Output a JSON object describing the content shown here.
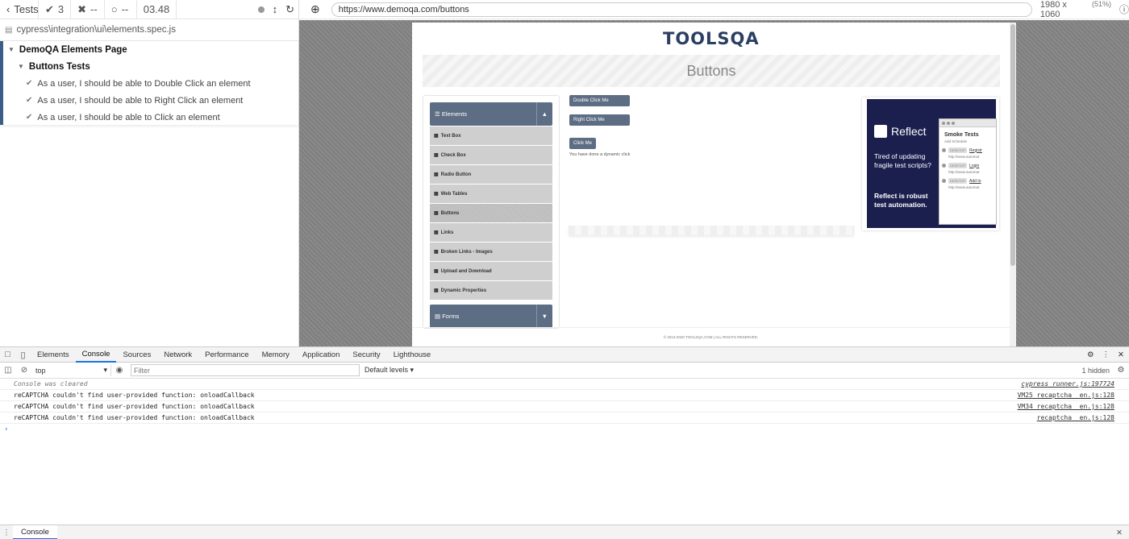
{
  "reporter": {
    "tests_label": "Tests",
    "passed": "3",
    "failed": "--",
    "pending": "--",
    "duration": "03.48",
    "spec_path": "cypress\\integration\\ui\\elements.spec.js",
    "suite": "DemoQA Elements Page",
    "subsuite": "Buttons Tests",
    "tests": [
      "As a user, I should be able to Double Click an element",
      "As a user, I should be able to Right Click an element",
      "As a user, I should be able to Click an element"
    ]
  },
  "urlbar": {
    "url": "https://www.demoqa.com/buttons",
    "viewport": "1980 x 1060",
    "scale": "(51%)"
  },
  "aut": {
    "logo_tools": "TOOLS",
    "logo_qa": "QA",
    "page_title": "Buttons",
    "groups": {
      "elements": "Elements",
      "forms": "Forms"
    },
    "menu": [
      "Text Box",
      "Check Box",
      "Radio Button",
      "Web Tables",
      "Buttons",
      "Links",
      "Broken Links - Images",
      "Upload and Download",
      "Dynamic Properties"
    ],
    "buttons": {
      "double": "Double Click Me",
      "right": "Right Click Me",
      "click": "Click Me"
    },
    "dynamic_message": "You have done a dynamic click",
    "ad": {
      "brand": "Reflect",
      "copy1": "Tired of updating fragile test scripts?",
      "copy2": "Reflect is robust test automation.",
      "shot_title": "Smoke Tests",
      "shot_sub": "Add Schedule",
      "rows": [
        "Registr",
        "Login",
        "Add to"
      ],
      "row_urls": [
        "http://www.automat",
        "http://www.automat",
        "http://www.automat"
      ],
      "pill": "DESKTOP"
    },
    "footer": "© 2013-2020 TOOLSQA.COM | ALL RIGHTS RESERVED."
  },
  "devtools": {
    "tabs": [
      "Elements",
      "Console",
      "Sources",
      "Network",
      "Performance",
      "Memory",
      "Application",
      "Security",
      "Lighthouse"
    ],
    "active_tab": "Console",
    "context": "top",
    "filter_placeholder": "Filter",
    "levels": "Default levels",
    "hidden": "1 hidden",
    "lines": [
      {
        "text": "Console was cleared",
        "src": "cypress_runner.js:197724"
      },
      {
        "text": "reCAPTCHA couldn't find user-provided function: onloadCallback",
        "src": "VM25 recaptcha__en.js:128"
      },
      {
        "text": "reCAPTCHA couldn't find user-provided function: onloadCallback",
        "src": "VM34 recaptcha__en.js:128"
      },
      {
        "text": "reCAPTCHA couldn't find user-provided function: onloadCallback",
        "src": "recaptcha__en.js:128"
      }
    ],
    "drawer_tab": "Console"
  }
}
